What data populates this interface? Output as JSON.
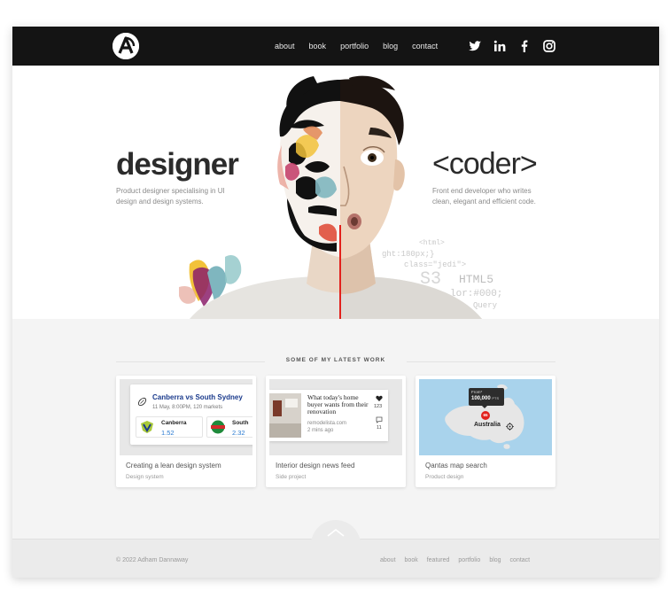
{
  "nav": {
    "links": [
      "about",
      "book",
      "portfolio",
      "blog",
      "contact"
    ],
    "social": [
      "twitter-icon",
      "linkedin-icon",
      "facebook-icon",
      "instagram-icon"
    ]
  },
  "hero": {
    "left_title": "designer",
    "left_desc": "Product designer specialising in UI design and design systems.",
    "right_title": "<coder>",
    "right_desc": "Front end developer who writes clean, elegant and efficient code.",
    "code_snippets": [
      "<html>",
      "ght:180px;}",
      "class=\"jedi\">",
      "S3",
      "HTML5",
      "lor:#000;",
      "Query"
    ]
  },
  "work": {
    "heading": "SOME OF MY LATEST WORK",
    "cards": [
      {
        "title": "Creating a lean design system",
        "subtitle": "Design system",
        "thumb": {
          "match": "Canberra vs South Sydney",
          "meta": "11 May, 8:00PM, 120 markets",
          "team1": "Canberra",
          "odds1": "1.52",
          "team2": "South",
          "odds2": "2.32"
        }
      },
      {
        "title": "Interior design news feed",
        "subtitle": "Side project",
        "thumb": {
          "headline": "What today's home buyer wants from their renovation",
          "source": "remodelista.com",
          "time": "2 mins ago",
          "likes": "123",
          "comments": "11"
        }
      },
      {
        "title": "Qantas map search",
        "subtitle": "Product design",
        "thumb": {
          "tooltip_label": "From*",
          "tooltip_value": "100,000",
          "tooltip_unit": "PTS",
          "pin": "65",
          "country": "Australia"
        }
      }
    ]
  },
  "footer": {
    "copyright": "© 2022 Adham Dannaway",
    "links": [
      "about",
      "book",
      "featured",
      "portfolio",
      "blog",
      "contact"
    ]
  },
  "colors": {
    "nav_bg": "#141414",
    "map_blue": "#a9d3ec",
    "pin_red": "#e2211c",
    "odds_blue": "#2a7bd1"
  }
}
